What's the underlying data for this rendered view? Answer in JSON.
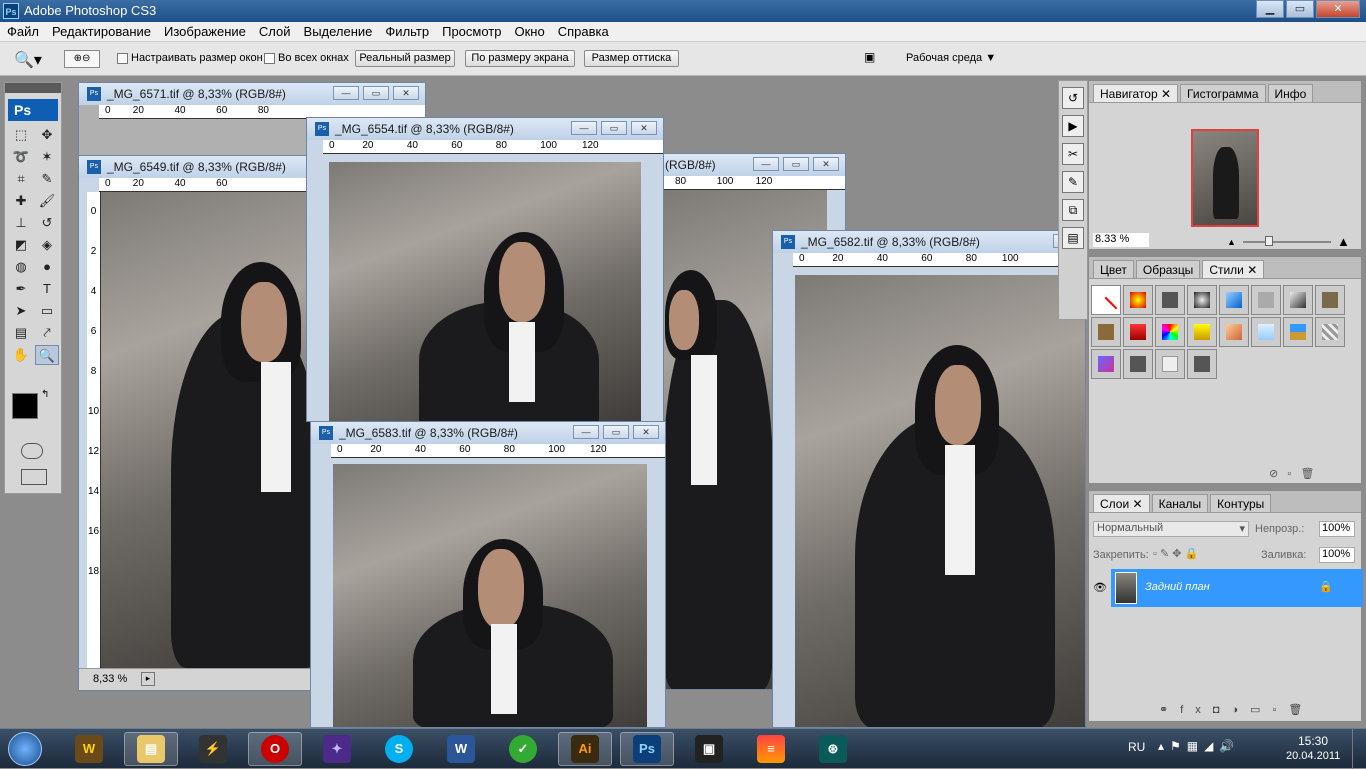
{
  "app": {
    "title": "Adobe Photoshop CS3",
    "logo": "Ps"
  },
  "menu": [
    "Файл",
    "Редактирование",
    "Изображение",
    "Слой",
    "Выделение",
    "Фильтр",
    "Просмотр",
    "Окно",
    "Справка"
  ],
  "options": {
    "resize_windows": "Настраивать размер окон",
    "all_windows": "Во всех окнах",
    "actual_pixels": "Реальный размер",
    "fit_screen": "По размеру экрана",
    "print_size": "Размер оттиска",
    "workspace": "Рабочая среда"
  },
  "documents": [
    {
      "title": "_MG_6571.tif @ 8,33% (RGB/8#)"
    },
    {
      "title": "_MG_6549.tif @ 8,33% (RGB/8#)",
      "zoom": "8,33 %"
    },
    {
      "title": "_MG_6554.tif @ 8,33% (RGB/8#)"
    },
    {
      "title": "_MG_6583.tif @ 8,33% (RGB/8#)"
    },
    {
      "title": "_MG_6582.tif @ 8,33% (RGB/8#)"
    },
    {
      "title": "(RGB/8#)"
    }
  ],
  "rulers": {
    "marks": [
      "0",
      "20",
      "40",
      "60",
      "80",
      "100",
      "120"
    ],
    "vmarks": [
      "0",
      "2",
      "4",
      "6",
      "8",
      "10",
      "12",
      "14",
      "16",
      "18"
    ]
  },
  "navigator": {
    "tabs": [
      "Навигатор",
      "Гистограмма",
      "Инфо"
    ],
    "zoom": "8.33 %"
  },
  "styles_panel": {
    "tabs": [
      "Цвет",
      "Образцы",
      "Стили"
    ]
  },
  "layers_panel": {
    "tabs": [
      "Слои",
      "Каналы",
      "Контуры"
    ],
    "blend_mode": "Нормальный",
    "opacity_label": "Непрозр.:",
    "opacity": "100%",
    "lock_label": "Закрепить:",
    "fill_label": "Заливка:",
    "fill": "100%",
    "layer_name": "Задний план"
  },
  "taskbar": {
    "lang": "RU",
    "time": "15:30",
    "date": "20.04.2011"
  },
  "colors": {
    "accent": "#3399ff",
    "layer_selected": "#3399ff"
  }
}
